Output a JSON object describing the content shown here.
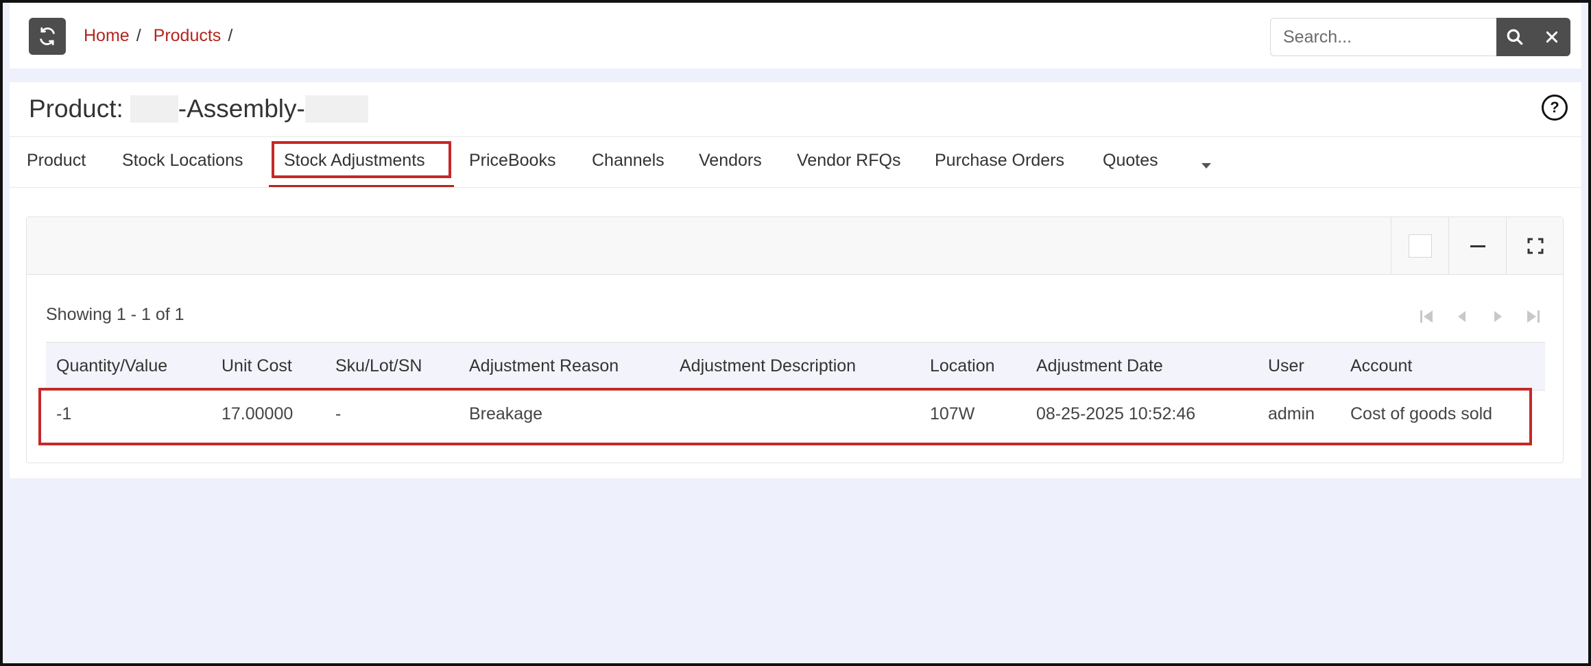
{
  "breadcrumb": {
    "home": "Home",
    "products": "Products",
    "sep": "/"
  },
  "search": {
    "placeholder": "Search..."
  },
  "page": {
    "title_prefix": "Product:",
    "title_middle": "-Assembly-"
  },
  "tabs": [
    {
      "label": "Product"
    },
    {
      "label": "Stock Locations"
    },
    {
      "label": "Stock Adjustments"
    },
    {
      "label": "PriceBooks"
    },
    {
      "label": "Channels"
    },
    {
      "label": "Vendors"
    },
    {
      "label": "Vendor RFQs"
    },
    {
      "label": "Purchase Orders"
    },
    {
      "label": "Quotes"
    }
  ],
  "grid": {
    "showing": "Showing 1 - 1 of 1",
    "columns": [
      "Quantity/Value",
      "Unit Cost",
      "Sku/Lot/SN",
      "Adjustment Reason",
      "Adjustment Description",
      "Location",
      "Adjustment Date",
      "User",
      "Account"
    ],
    "rows": [
      [
        "-1",
        "17.00000",
        "-",
        "Breakage",
        "",
        "107W",
        "08-25-2025 10:52:46",
        "admin",
        "Cost of goods sold"
      ]
    ]
  },
  "colors": {
    "accent_red": "#b3261e",
    "dark_button": "#4d4d4d",
    "highlight": "#c62828"
  }
}
